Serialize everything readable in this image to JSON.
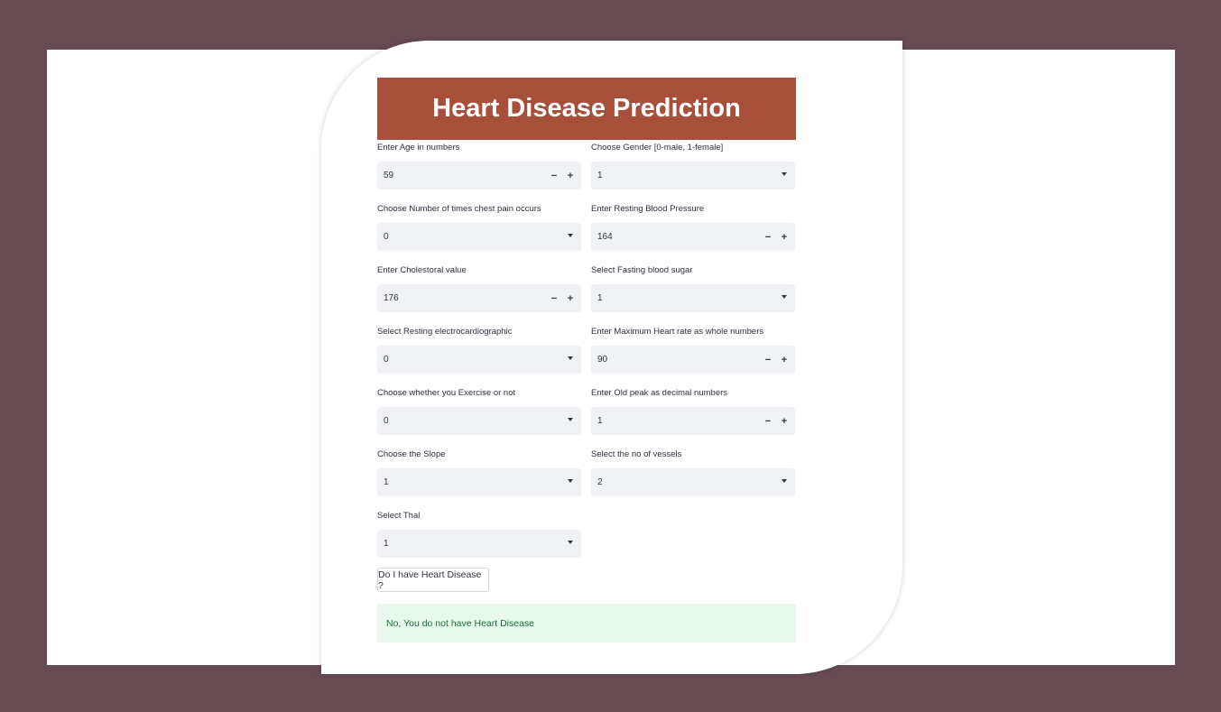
{
  "colors": {
    "background": "#684a53",
    "banner": "#a84f3c",
    "input_bg": "#f0f2f6",
    "success_bg": "#e9f8ec",
    "success_text": "#177233"
  },
  "title": "Heart Disease Prediction",
  "fields": [
    {
      "id": "age",
      "label": "Enter Age in numbers",
      "value": "59",
      "type": "number"
    },
    {
      "id": "gender",
      "label": "Choose Gender [0-male, 1-female]",
      "value": "1",
      "type": "select"
    },
    {
      "id": "chest-pain",
      "label": "Choose Number of times chest pain occurs",
      "value": "0",
      "type": "select"
    },
    {
      "id": "resting-bp",
      "label": "Enter Resting Blood Pressure",
      "value": "164",
      "type": "number"
    },
    {
      "id": "cholesterol",
      "label": "Enter Cholestoral value",
      "value": "176",
      "type": "number"
    },
    {
      "id": "fasting-sugar",
      "label": "Select Fasting blood sugar",
      "value": "1",
      "type": "select"
    },
    {
      "id": "resting-ecg",
      "label": "Select Resting electrocardiographic",
      "value": "0",
      "type": "select"
    },
    {
      "id": "max-heart-rate",
      "label": "Enter Maximum Heart rate as whole numbers",
      "value": "90",
      "type": "number"
    },
    {
      "id": "exercise",
      "label": "Choose whether you Exercise or not",
      "value": "0",
      "type": "select"
    },
    {
      "id": "old-peak",
      "label": "Enter Old peak as decimal numbers",
      "value": "1",
      "type": "number"
    },
    {
      "id": "slope",
      "label": "Choose the Slope",
      "value": "1",
      "type": "select"
    },
    {
      "id": "vessels",
      "label": "Select the no of vessels",
      "value": "2",
      "type": "select"
    },
    {
      "id": "thal",
      "label": "Select Thal",
      "value": "1",
      "type": "select"
    }
  ],
  "stepper": {
    "minus": "−",
    "plus": "+"
  },
  "predict_button": "Do I have Heart Disease ?",
  "result": "No, You do not have Heart Disease"
}
